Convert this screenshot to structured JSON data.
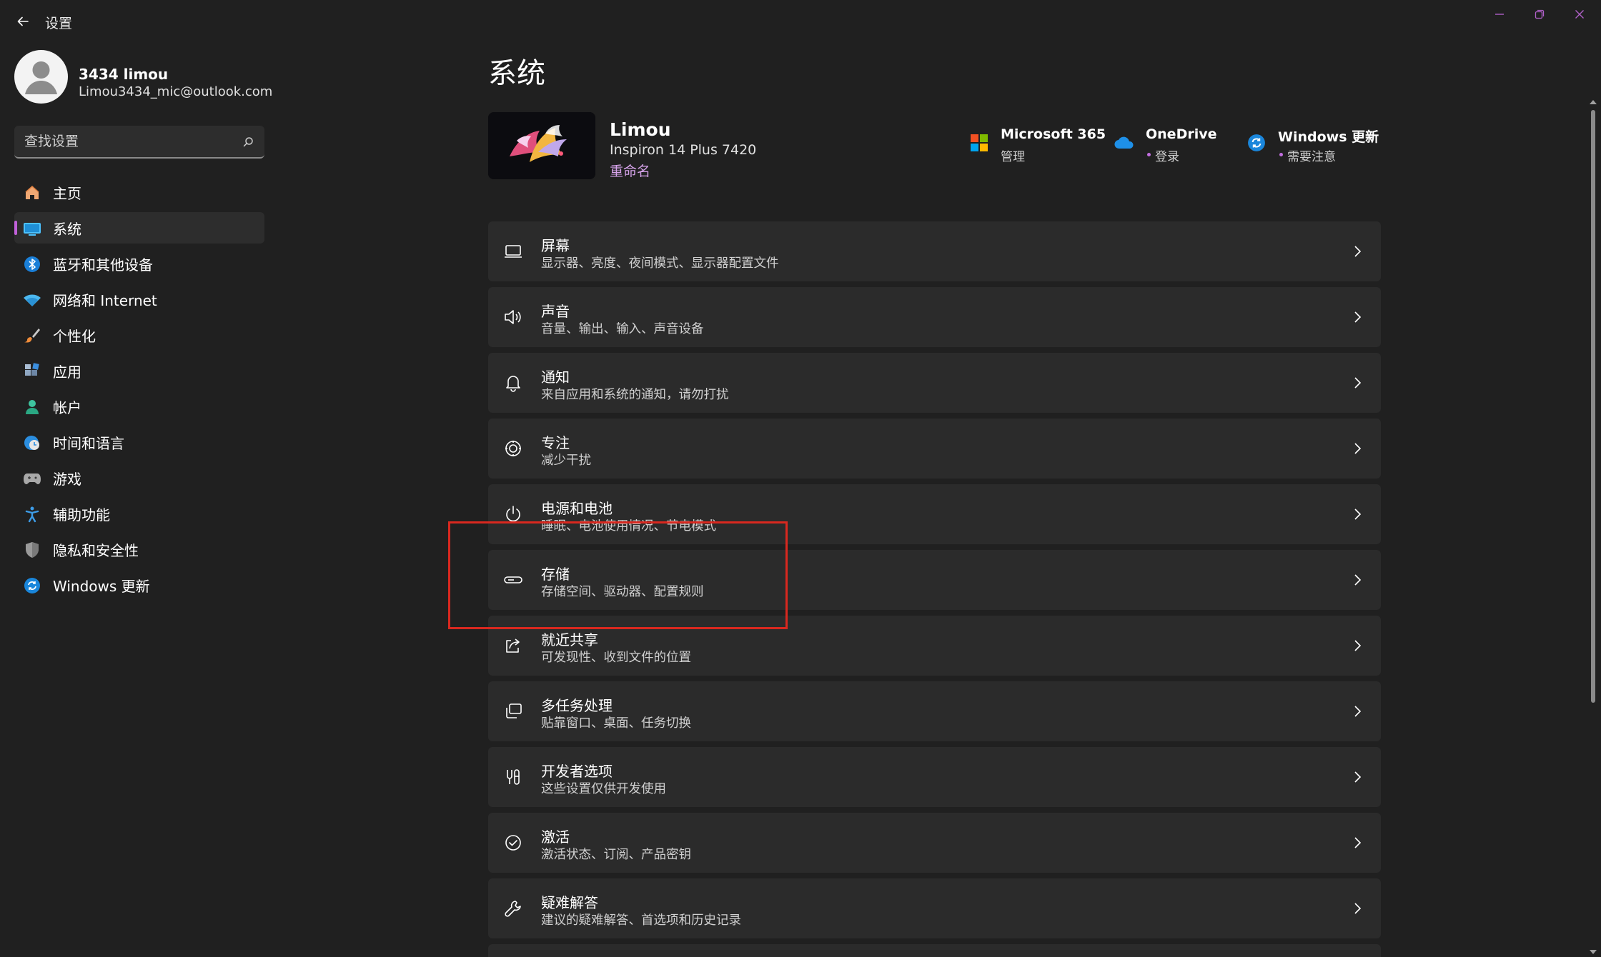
{
  "window": {
    "title": "设置"
  },
  "user": {
    "name": "3434 limou",
    "email": "Limou3434_mic@outlook.com"
  },
  "search": {
    "placeholder": "查找设置"
  },
  "sidebar": {
    "items": [
      {
        "label": "主页",
        "icon": "home-icon",
        "selected": false
      },
      {
        "label": "系统",
        "icon": "system-icon",
        "selected": true
      },
      {
        "label": "蓝牙和其他设备",
        "icon": "bluetooth-icon",
        "selected": false
      },
      {
        "label": "网络和 Internet",
        "icon": "wifi-icon",
        "selected": false
      },
      {
        "label": "个性化",
        "icon": "brush-icon",
        "selected": false
      },
      {
        "label": "应用",
        "icon": "apps-icon",
        "selected": false
      },
      {
        "label": "帐户",
        "icon": "account-icon",
        "selected": false
      },
      {
        "label": "时间和语言",
        "icon": "globe-clock-icon",
        "selected": false
      },
      {
        "label": "游戏",
        "icon": "gamepad-icon",
        "selected": false
      },
      {
        "label": "辅助功能",
        "icon": "accessibility-icon",
        "selected": false
      },
      {
        "label": "隐私和安全性",
        "icon": "shield-icon",
        "selected": false
      },
      {
        "label": "Windows 更新",
        "icon": "update-icon",
        "selected": false
      }
    ]
  },
  "main": {
    "title": "系统",
    "device": {
      "name": "Limou",
      "model": "Inspiron 14 Plus 7420",
      "rename_label": "重命名"
    },
    "quick_links": [
      {
        "title": "Microsoft 365",
        "subtitle": "管理",
        "icon": "microsoft-logo-icon",
        "dot": false
      },
      {
        "title": "OneDrive",
        "subtitle": "登录",
        "icon": "onedrive-icon",
        "dot": true
      },
      {
        "title": "Windows 更新",
        "subtitle": "需要注意",
        "icon": "windows-update-icon",
        "dot": true
      }
    ],
    "cards": [
      {
        "title": "屏幕",
        "subtitle": "显示器、亮度、夜间模式、显示器配置文件",
        "icon": "display-icon"
      },
      {
        "title": "声音",
        "subtitle": "音量、输出、输入、声音设备",
        "icon": "speaker-icon"
      },
      {
        "title": "通知",
        "subtitle": "来自应用和系统的通知，请勿打扰",
        "icon": "bell-icon"
      },
      {
        "title": "专注",
        "subtitle": "减少干扰",
        "icon": "focus-icon"
      },
      {
        "title": "电源和电池",
        "subtitle": "睡眠、电池使用情况、节电模式",
        "icon": "power-icon"
      },
      {
        "title": "存储",
        "subtitle": "存储空间、驱动器、配置规则",
        "icon": "storage-icon"
      },
      {
        "title": "就近共享",
        "subtitle": "可发现性、收到文件的位置",
        "icon": "share-icon"
      },
      {
        "title": "多任务处理",
        "subtitle": "贴靠窗口、桌面、任务切换",
        "icon": "multitask-icon"
      },
      {
        "title": "开发者选项",
        "subtitle": "这些设置仅供开发使用",
        "icon": "developer-icon"
      },
      {
        "title": "激活",
        "subtitle": "激活状态、订阅、产品密钥",
        "icon": "check-circle-icon"
      },
      {
        "title": "疑难解答",
        "subtitle": "建议的疑难解答、首选项和历史记录",
        "icon": "wrench-icon"
      }
    ]
  },
  "colors": {
    "background": "#202020",
    "card": "#2b2b2b",
    "accent": "#c060d8",
    "highlight": "#d9281f"
  }
}
